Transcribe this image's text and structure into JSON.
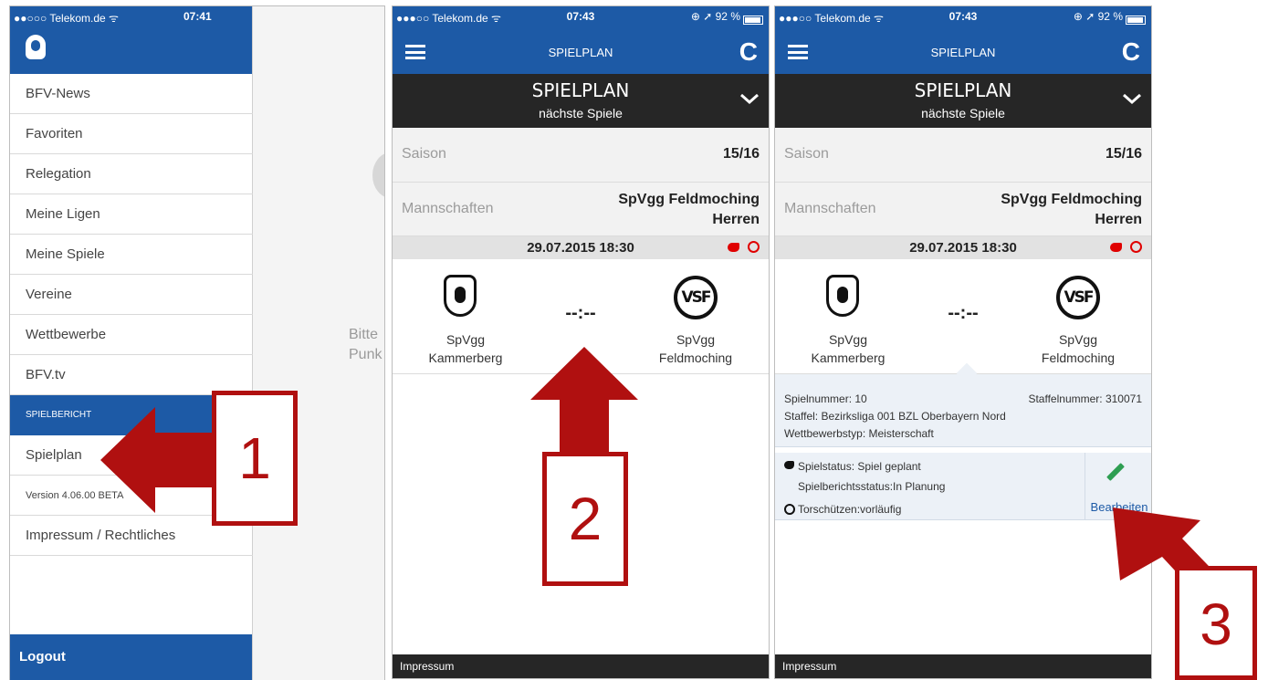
{
  "panel1": {
    "status": {
      "carrier": "●●○○○ Telekom.de ᯤ",
      "time": "07:41"
    },
    "menu": {
      "items": [
        {
          "label": "BFV-News",
          "style": "normal"
        },
        {
          "label": "Favoriten",
          "style": "normal"
        },
        {
          "label": "Relegation",
          "style": "normal"
        },
        {
          "label": "Meine Ligen",
          "style": "normal"
        },
        {
          "label": "Meine Spiele",
          "style": "normal"
        },
        {
          "label": "Vereine",
          "style": "normal"
        },
        {
          "label": "Wettbewerbe",
          "style": "normal"
        },
        {
          "label": "BFV.tv",
          "style": "normal"
        },
        {
          "label": "SPIELBERICHT",
          "style": "section"
        },
        {
          "label": "Spielplan",
          "style": "normal"
        },
        {
          "label": "Version 4.06.00 BETA",
          "style": "small"
        },
        {
          "label": "Impressum / Rechtliches",
          "style": "normal"
        }
      ],
      "logout_label": "Logout"
    },
    "background_text": {
      "line1": "Bitte",
      "line2": "Punk"
    }
  },
  "schedule": {
    "nav_title": "SPIELPLAN",
    "header_title": "SPIELPLAN",
    "header_subtitle": "nächste Spiele",
    "season_label": "Saison",
    "season_value": "15/16",
    "teams_label": "Mannschaften",
    "teams_value_line1": "SpVgg Feldmoching",
    "teams_value_line2": "Herren",
    "match_datetime": "29.07.2015 18:30",
    "home_team_line1": "SpVgg",
    "home_team_line2": "Kammerberg",
    "away_team_line1": "SpVgg",
    "away_team_line2": "Feldmoching",
    "away_crest_text": "VSF",
    "score": "--:--",
    "footer_label": "Impressum"
  },
  "panel2": {
    "status": {
      "carrier": "●●●○○ Telekom.de ᯤ",
      "time": "07:43",
      "battery": "⊕ ➚ 92 %"
    }
  },
  "panel3": {
    "status": {
      "carrier": "●●●○○ Telekom.de ᯤ",
      "time": "07:43",
      "battery": "⊕ ➚ 92 %"
    },
    "details": {
      "game_number": "Spielnummer: 10",
      "group_number": "Staffelnummer: 310071",
      "group": "Staffel: Bezirksliga 001 BZL Oberbayern Nord",
      "competition_type": "Wettbewerbstyp: Meisterschaft"
    },
    "game_status": {
      "status": "Spielstatus: Spiel geplant",
      "report_status": "Spielberichtsstatus:In Planung",
      "scorers": "Torschützen:vorläufig",
      "edit_label": "Bearbeiten"
    }
  },
  "annotations": {
    "label1": "1",
    "label2": "2",
    "label3": "3"
  },
  "colors": {
    "brand_blue": "#1d5aa6",
    "header_black": "#262626",
    "annotation_red": "#b01010",
    "status_red": "#e00000",
    "edit_green": "#2e9e52"
  },
  "icons": [
    "user-avatar-icon",
    "hamburger-menu-icon",
    "refresh-icon",
    "chevron-down-icon",
    "whistle-icon",
    "soccer-ball-icon",
    "pencil-edit-icon"
  ]
}
